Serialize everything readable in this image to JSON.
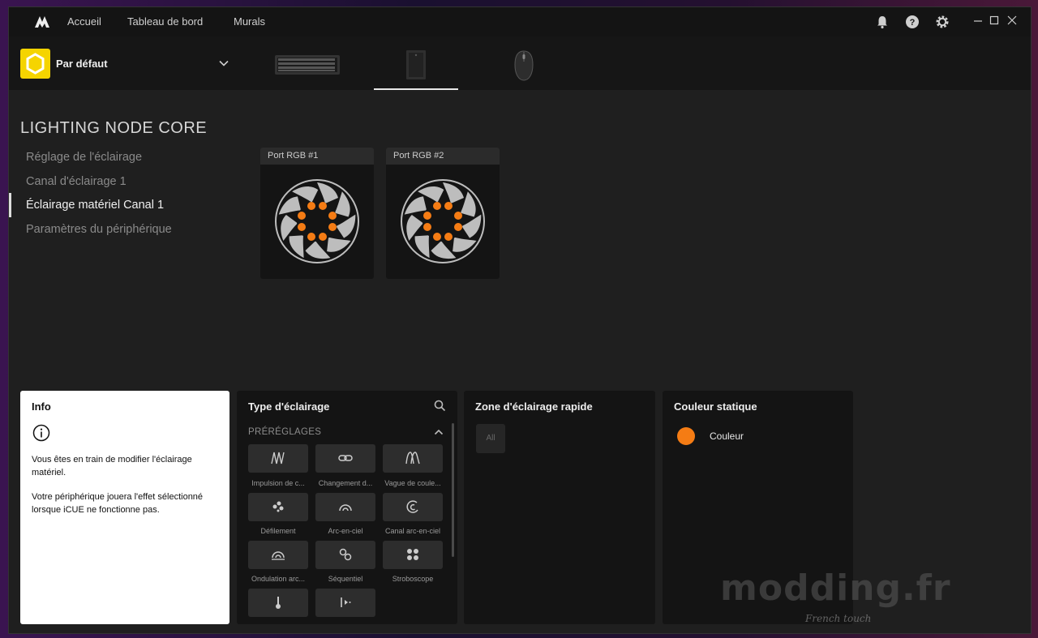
{
  "nav": {
    "items": [
      "Accueil",
      "Tableau de bord",
      "Murals"
    ]
  },
  "profile": {
    "name": "Par défaut"
  },
  "device": {
    "title": "LIGHTING NODE CORE"
  },
  "menu": {
    "items": [
      "Réglage de l'éclairage",
      "Canal d'éclairage 1",
      "Éclairage matériel Canal 1",
      "Paramètres du périphérique"
    ],
    "active_index": 2
  },
  "ports": [
    {
      "label": "Port RGB #1"
    },
    {
      "label": "Port RGB #2"
    }
  ],
  "info": {
    "title": "Info",
    "text1": "Vous êtes en train de modifier l'éclairage matériel.",
    "text2": "Votre périphérique jouera l'effet sélectionné lorsque iCUE ne fonctionne pas."
  },
  "lighting_type": {
    "title": "Type d'éclairage",
    "section": "PRÉRÉGLAGES",
    "presets": [
      {
        "label": "Impulsion de c...",
        "icon": "pulse-icon"
      },
      {
        "label": "Changement d...",
        "icon": "link-icon"
      },
      {
        "label": "Vague de coule...",
        "icon": "wave-icon"
      },
      {
        "label": "Défilement",
        "icon": "scroll-icon"
      },
      {
        "label": "Arc-en-ciel",
        "icon": "rainbow-icon"
      },
      {
        "label": "Canal arc-en-ciel",
        "icon": "channel-rainbow-icon"
      },
      {
        "label": "Ondulation arc...",
        "icon": "ripple-icon"
      },
      {
        "label": "Séquentiel",
        "icon": "sequential-icon"
      },
      {
        "label": "Stroboscope",
        "icon": "strobe-icon"
      },
      {
        "label": "",
        "icon": "temperature-icon"
      },
      {
        "label": "",
        "icon": "play-marker-icon"
      }
    ]
  },
  "quick_zone": {
    "title": "Zone d'éclairage rapide",
    "all_label": "All"
  },
  "static_color": {
    "title": "Couleur statique",
    "color_label": "Couleur",
    "color": "#f57c14"
  },
  "watermark": {
    "main": "modding.fr",
    "sub": "French touch"
  }
}
